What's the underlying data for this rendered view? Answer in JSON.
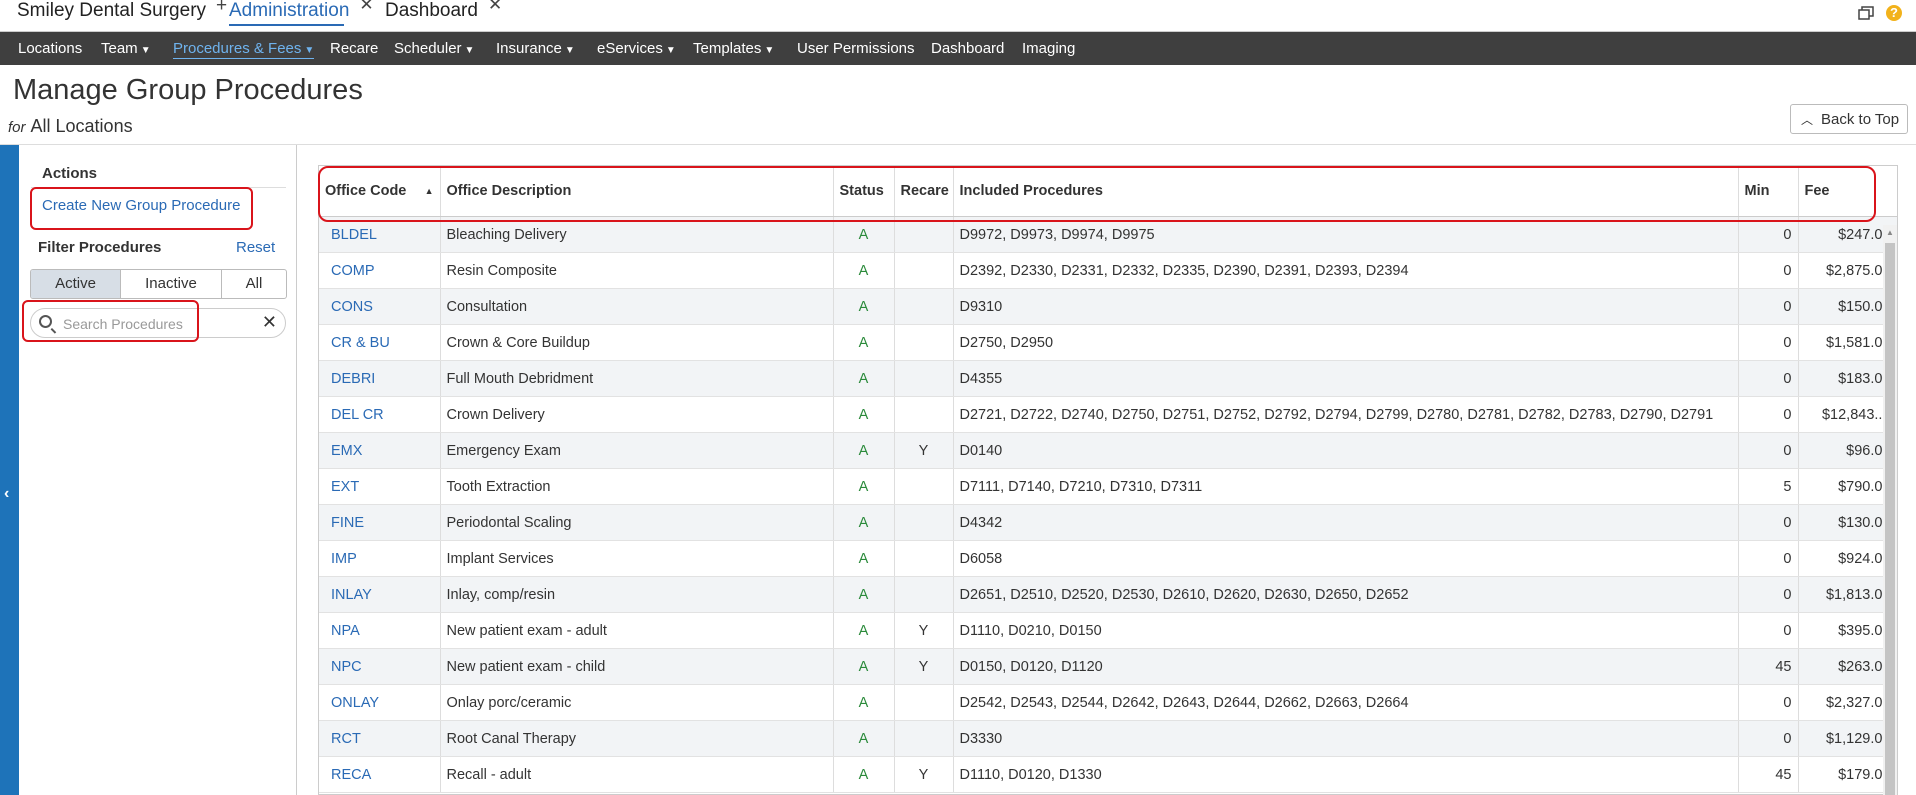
{
  "tabs": {
    "app_name": "Smiley Dental Surgery",
    "admin": "Administration",
    "dashboard": "Dashboard"
  },
  "nav": {
    "items": [
      "Locations",
      "Team",
      "Procedures & Fees",
      "Recare",
      "Scheduler",
      "Insurance",
      "eServices",
      "Templates",
      "User Permissions",
      "Dashboard",
      "Imaging"
    ]
  },
  "page": {
    "title": "Manage Group Procedures",
    "for_label": "for",
    "location": "All Locations",
    "back_to_top": "Back to Top"
  },
  "sidebar": {
    "actions_label": "Actions",
    "create_link": "Create New Group Procedure",
    "filter_label": "Filter Procedures",
    "reset_label": "Reset",
    "segments": [
      "Active",
      "Inactive",
      "All"
    ],
    "active_segment": "Active",
    "search_placeholder": "Search Procedures"
  },
  "table": {
    "headers": [
      "Office Code",
      "Office Description",
      "Status",
      "Recare",
      "Included Procedures",
      "Min",
      "Fee"
    ],
    "sort_column": "Office Code",
    "rows": [
      [
        "BLDEL",
        "Bleaching Delivery",
        "A",
        "",
        "D9972, D9973, D9974, D9975",
        "0",
        "$247.00"
      ],
      [
        "COMP",
        "Resin Composite",
        "A",
        "",
        "D2392, D2330, D2331, D2332, D2335, D2390, D2391, D2393, D2394",
        "0",
        "$2,875.00"
      ],
      [
        "CONS",
        "Consultation",
        "A",
        "",
        "D9310",
        "0",
        "$150.00"
      ],
      [
        "CR & BU",
        "Crown & Core Buildup",
        "A",
        "",
        "D2750, D2950",
        "0",
        "$1,581.00"
      ],
      [
        "DEBRI",
        "Full Mouth Debridment",
        "A",
        "",
        "D4355",
        "0",
        "$183.00"
      ],
      [
        "DEL CR",
        "Crown Delivery",
        "A",
        "",
        "D2721, D2722, D2740, D2750, D2751, D2752, D2792, D2794, D2799, D2780, D2781, D2782, D2783, D2790, D2791",
        "0",
        "$12,843...."
      ],
      [
        "EMX",
        "Emergency Exam",
        "A",
        "Y",
        "D0140",
        "0",
        "$96.00"
      ],
      [
        "EXT",
        "Tooth Extraction",
        "A",
        "",
        "D7111, D7140, D7210, D7310, D7311",
        "5",
        "$790.00"
      ],
      [
        "FINE",
        "Periodontal Scaling",
        "A",
        "",
        "D4342",
        "0",
        "$130.00"
      ],
      [
        "IMP",
        "Implant Services",
        "A",
        "",
        "D6058",
        "0",
        "$924.00"
      ],
      [
        "INLAY",
        "Inlay, comp/resin",
        "A",
        "",
        "D2651, D2510, D2520, D2530, D2610, D2620, D2630, D2650, D2652",
        "0",
        "$1,813.00"
      ],
      [
        "NPA",
        "New patient exam - adult",
        "A",
        "Y",
        "D1110, D0210, D0150",
        "0",
        "$395.00"
      ],
      [
        "NPC",
        "New patient exam - child",
        "A",
        "Y",
        "D0150, D0120, D1120",
        "45",
        "$263.00"
      ],
      [
        "ONLAY",
        "Onlay porc/ceramic",
        "A",
        "",
        "D2542, D2543, D2544, D2642, D2643, D2644, D2662, D2663, D2664",
        "0",
        "$2,327.00"
      ],
      [
        "RCT",
        "Root Canal Therapy",
        "A",
        "",
        "D3330",
        "0",
        "$1,129.00"
      ],
      [
        "RECA",
        "Recall - adult",
        "A",
        "Y",
        "D1110, D0120, D1330",
        "45",
        "$179.00"
      ]
    ]
  }
}
